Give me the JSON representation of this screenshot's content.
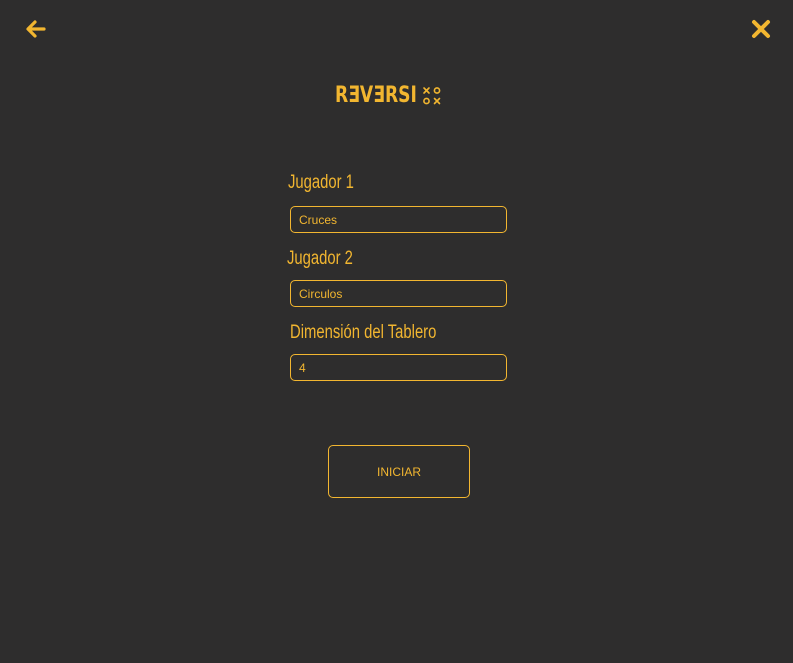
{
  "header": {
    "back_icon": "arrow-left-icon",
    "close_icon": "close-icon"
  },
  "logo": {
    "text": "RƎVƎRSI",
    "mark_icon": "tic-tac-toe-marks-icon"
  },
  "form": {
    "player1": {
      "label": "Jugador 1",
      "value": "Cruces"
    },
    "player2": {
      "label": "Jugador 2",
      "value": "Circulos"
    },
    "board_size": {
      "label": "Dimensión del Tablero",
      "value": "4"
    },
    "start_label": "INICIAR"
  },
  "colors": {
    "background": "#2e2d2d",
    "accent": "#f2b630"
  }
}
